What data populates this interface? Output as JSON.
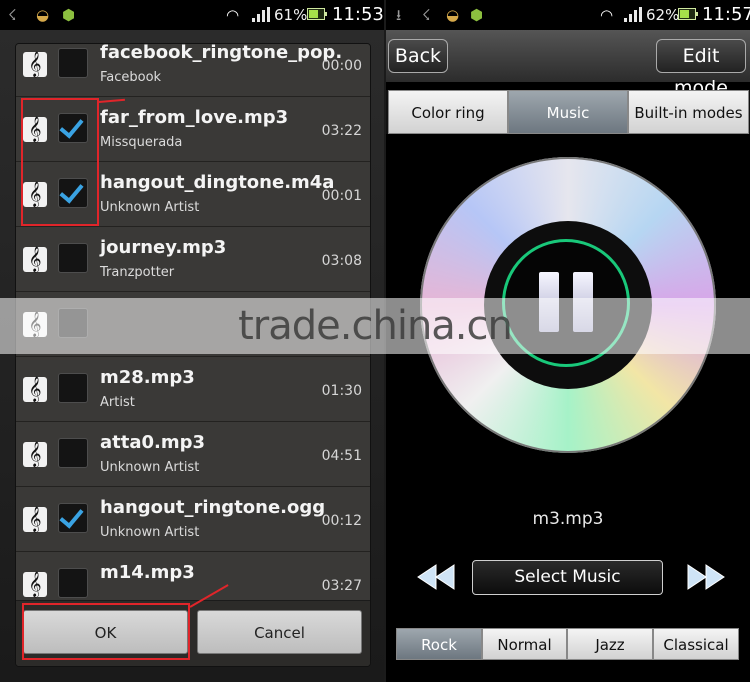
{
  "left_phone": {
    "status": {
      "battery_text": "61%",
      "time": "11:53",
      "battery_level": 0.61
    },
    "songs": [
      {
        "title": "facebook_ringtone_pop.",
        "artist": "Facebook",
        "duration": "00:00",
        "checked": false
      },
      {
        "title": "far_from_love.mp3",
        "artist": "Missquerada",
        "duration": "03:22",
        "checked": true
      },
      {
        "title": "hangout_dingtone.m4a",
        "artist": "Unknown Artist",
        "duration": "00:01",
        "checked": true
      },
      {
        "title": "journey.mp3",
        "artist": "Tranzpotter",
        "duration": "03:08",
        "checked": false
      },
      {
        "title": "",
        "artist": "",
        "duration": "",
        "checked": false
      },
      {
        "title": "m28.mp3",
        "artist": "Artist",
        "duration": "01:30",
        "checked": false
      },
      {
        "title": "atta0.mp3",
        "artist": "Unknown Artist",
        "duration": "04:51",
        "checked": false
      },
      {
        "title": "hangout_ringtone.ogg",
        "artist": "Unknown Artist",
        "duration": "00:12",
        "checked": true
      },
      {
        "title": "m14.mp3",
        "artist": "",
        "duration": "03:27",
        "checked": false
      }
    ],
    "buttons": {
      "ok": "OK",
      "cancel": "Cancel"
    }
  },
  "right_phone": {
    "status": {
      "battery_text": "62%",
      "time": "11:57",
      "battery_level": 0.62
    },
    "header": {
      "back": "Back",
      "edit_mode": "Edit mode"
    },
    "tabs": [
      {
        "label": "Color ring",
        "selected": false
      },
      {
        "label": "Music",
        "selected": true
      },
      {
        "label": "Built-in modes",
        "selected": false
      }
    ],
    "now_playing": "m3.mp3",
    "select_music": "Select Music",
    "eq_modes": [
      {
        "label": "Rock",
        "selected": true
      },
      {
        "label": "Normal",
        "selected": false
      },
      {
        "label": "Jazz",
        "selected": false
      },
      {
        "label": "Classical",
        "selected": false
      }
    ]
  },
  "watermark": "trade.china.cn",
  "colors": {
    "accent_check": "#3aa3e3",
    "annotation_red": "#e0252a",
    "player_ring": "#19c87a"
  }
}
